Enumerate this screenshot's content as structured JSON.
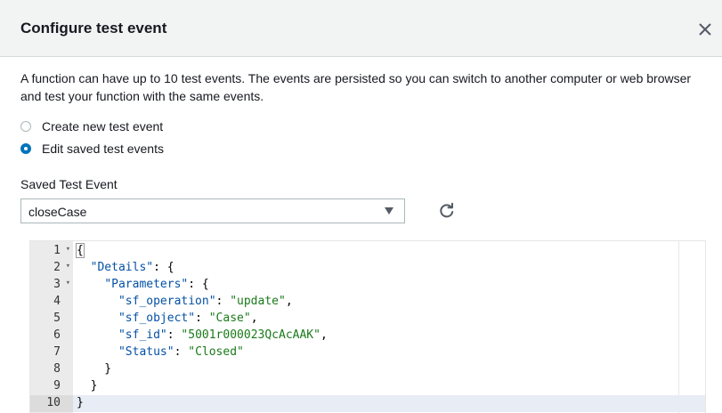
{
  "dialog": {
    "title": "Configure test event",
    "description": "A function can have up to 10 test events. The events are persisted so you can switch to another computer or web browser and test your function with the same events."
  },
  "options": [
    {
      "label": "Create new test event",
      "checked": false
    },
    {
      "label": "Edit saved test events",
      "checked": true
    }
  ],
  "saved_event": {
    "label": "Saved Test Event",
    "value": "closeCase"
  },
  "icons": {
    "close": "close-icon",
    "refresh": "refresh-icon",
    "dropdown": "caret-down-icon"
  },
  "colors": {
    "accent": "#0073bb",
    "header_bg": "#f2f3f3",
    "json_key": "#0451a5",
    "json_string": "#1a7a1a"
  },
  "editor": {
    "lines": [
      {
        "n": "1",
        "fold": true,
        "tokens": [
          [
            "p",
            "{"
          ]
        ]
      },
      {
        "n": "2",
        "fold": true,
        "tokens": [
          [
            "p",
            "  "
          ],
          [
            "k",
            "\"Details\""
          ],
          [
            "p",
            ": {"
          ]
        ]
      },
      {
        "n": "3",
        "fold": true,
        "tokens": [
          [
            "p",
            "    "
          ],
          [
            "k",
            "\"Parameters\""
          ],
          [
            "p",
            ": {"
          ]
        ]
      },
      {
        "n": "4",
        "fold": false,
        "tokens": [
          [
            "p",
            "      "
          ],
          [
            "k",
            "\"sf_operation\""
          ],
          [
            "p",
            ": "
          ],
          [
            "s",
            "\"update\""
          ],
          [
            "p",
            ","
          ]
        ]
      },
      {
        "n": "5",
        "fold": false,
        "tokens": [
          [
            "p",
            "      "
          ],
          [
            "k",
            "\"sf_object\""
          ],
          [
            "p",
            ": "
          ],
          [
            "s",
            "\"Case\""
          ],
          [
            "p",
            ","
          ]
        ]
      },
      {
        "n": "6",
        "fold": false,
        "tokens": [
          [
            "p",
            "      "
          ],
          [
            "k",
            "\"sf_id\""
          ],
          [
            "p",
            ": "
          ],
          [
            "s",
            "\"5001r000023QcAcAAK\""
          ],
          [
            "p",
            ","
          ]
        ]
      },
      {
        "n": "7",
        "fold": false,
        "tokens": [
          [
            "p",
            "      "
          ],
          [
            "k",
            "\"Status\""
          ],
          [
            "p",
            ": "
          ],
          [
            "s",
            "\"Closed\""
          ]
        ]
      },
      {
        "n": "8",
        "fold": false,
        "tokens": [
          [
            "p",
            "    }"
          ]
        ]
      },
      {
        "n": "9",
        "fold": false,
        "tokens": [
          [
            "p",
            "  }"
          ]
        ]
      },
      {
        "n": "10",
        "fold": false,
        "tokens": [
          [
            "p",
            "}"
          ]
        ]
      }
    ],
    "active_line": "10"
  }
}
